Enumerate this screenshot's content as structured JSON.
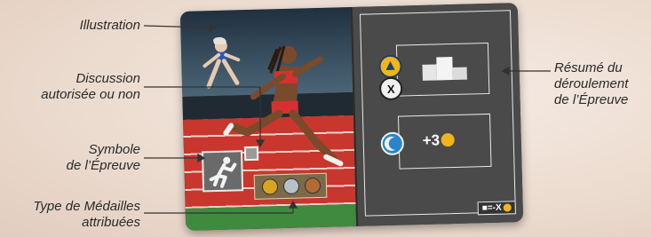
{
  "labels": {
    "illustration": "Illustration",
    "discussion_line1": "Discussion",
    "discussion_line2": "autorisée ou non",
    "symbole_line1": "Symbole",
    "symbole_line2": "de l’Épreuve",
    "medailles_line1": "Type de Médailles",
    "medailles_line2": "attribuées",
    "resume_line1": "Résumé du",
    "resume_line2": "déroulement",
    "resume_line3": "de l’Épreuve"
  },
  "card": {
    "bonus_text": "+3",
    "formula_text": "=-X"
  },
  "colors": {
    "label_text": "#2a2a2a",
    "card_panel": "#4a4a4a",
    "track_red": "#c9362e",
    "grass_green": "#3f8a3f",
    "sun_yellow": "#f2b51d",
    "moon_blue": "#2a86c9",
    "gold": "#d9a520",
    "silver": "#b8c0c8",
    "bronze": "#b46a38"
  },
  "icons": [
    "sun-icon",
    "moon-icon",
    "x-dice-icon",
    "podium-icon",
    "lightning-icon",
    "runner-icon",
    "medal-icon"
  ]
}
